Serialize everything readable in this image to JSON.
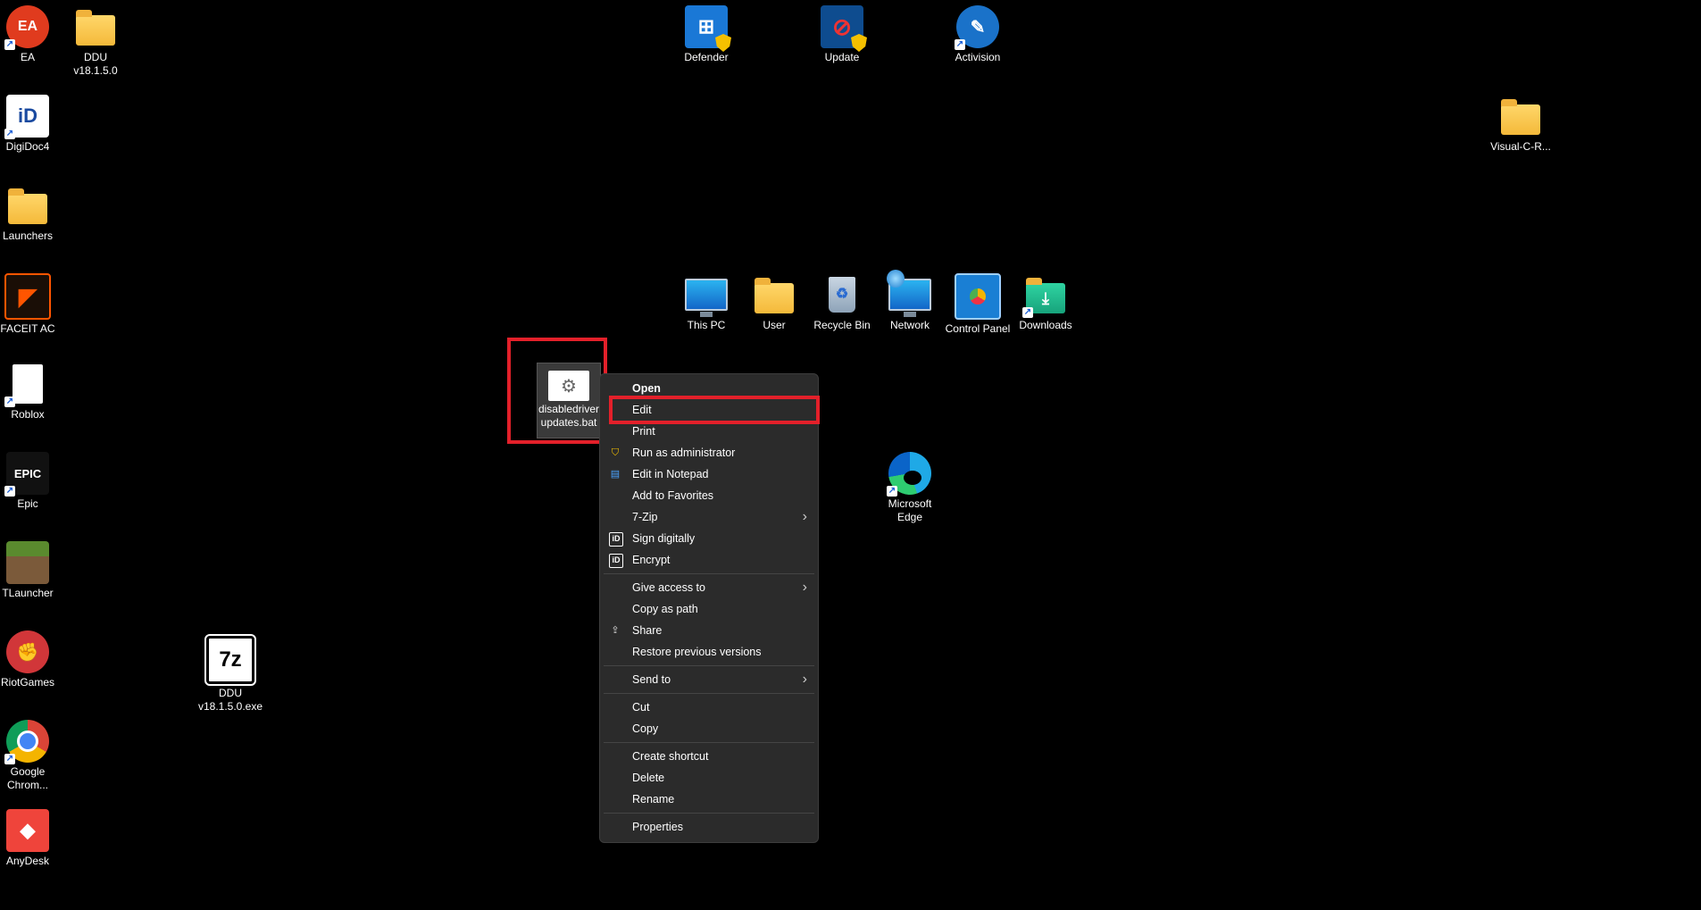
{
  "desktop": {
    "left_column": [
      {
        "label": "EA",
        "icon": "ea-icon",
        "color": "#e03b1e",
        "text": "EA"
      },
      {
        "label": "DigiDoc4",
        "icon": "digidoc-icon",
        "color": "#ffffff",
        "text": "iD"
      },
      {
        "label": "Launchers",
        "icon": "folder-icon",
        "color": "#f4b93a",
        "text": ""
      },
      {
        "label": "FACEIT AC",
        "icon": "faceit-icon",
        "color": "#ff5500",
        "text": "◤"
      },
      {
        "label": "Roblox",
        "icon": "file-icon",
        "color": "#ffffff",
        "text": ""
      },
      {
        "label": "Epic",
        "icon": "epic-games-icon",
        "color": "#111111",
        "text": "EPIC"
      },
      {
        "label": "TLauncher",
        "icon": "tlauncher-icon",
        "color": "#5a8a2e",
        "text": ""
      },
      {
        "label": "RiotGames",
        "icon": "riot-games-icon",
        "color": "#d13639",
        "text": "✊"
      },
      {
        "label": "Google Chrom...",
        "icon": "chrome-icon",
        "color": "#4285f4",
        "text": "●"
      },
      {
        "label": "AnyDesk",
        "icon": "anydesk-icon",
        "color": "#ef443b",
        "text": "◆"
      }
    ],
    "ddu_folder": {
      "label": "DDU v18.1.5.0",
      "icon": "folder-icon"
    },
    "ddu_exe": {
      "label": "DDU v18.1.5.0.exe",
      "icon": "7zip-icon",
      "text": "7z"
    },
    "top_row": [
      {
        "label": "Defender",
        "icon": "defender-icon"
      },
      {
        "label": "Update",
        "icon": "update-icon"
      },
      {
        "label": "Activision",
        "icon": "activision-icon"
      }
    ],
    "visual_c": {
      "label": "Visual-C-R...",
      "icon": "folder-icon"
    },
    "system_row": [
      {
        "label": "This PC",
        "icon": "this-pc-icon"
      },
      {
        "label": "User",
        "icon": "folder-icon"
      },
      {
        "label": "Recycle Bin",
        "icon": "recycle-bin-icon"
      },
      {
        "label": "Network",
        "icon": "network-icon"
      },
      {
        "label": "Control Panel",
        "icon": "control-panel-icon"
      },
      {
        "label": "Downloads",
        "icon": "downloads-icon"
      }
    ],
    "edge": {
      "label": "Microsoft Edge",
      "icon": "edge-icon"
    },
    "selected_file": {
      "label": "disabledriver updates.bat",
      "icon": "batch-file-icon"
    }
  },
  "context_menu": {
    "items": [
      {
        "label": "Open",
        "bold": true
      },
      {
        "label": "Edit"
      },
      {
        "label": "Print"
      },
      {
        "label": "Run as administrator",
        "icon": "uac-shield-icon"
      },
      {
        "label": "Edit in Notepad",
        "icon": "notepad-icon"
      },
      {
        "label": "Add to Favorites"
      },
      {
        "label": "7-Zip",
        "submenu": true
      },
      {
        "label": "Sign digitally",
        "icon": "digidoc-icon"
      },
      {
        "label": "Encrypt",
        "icon": "digidoc-icon"
      },
      {
        "sep": true
      },
      {
        "label": "Give access to",
        "submenu": true
      },
      {
        "label": "Copy as path"
      },
      {
        "label": "Share",
        "icon": "share-icon"
      },
      {
        "label": "Restore previous versions"
      },
      {
        "sep": true
      },
      {
        "label": "Send to",
        "submenu": true
      },
      {
        "sep": true
      },
      {
        "label": "Cut"
      },
      {
        "label": "Copy"
      },
      {
        "sep": true
      },
      {
        "label": "Create shortcut"
      },
      {
        "label": "Delete"
      },
      {
        "label": "Rename"
      },
      {
        "sep": true
      },
      {
        "label": "Properties"
      }
    ]
  },
  "highlight_color": "#e3202a"
}
